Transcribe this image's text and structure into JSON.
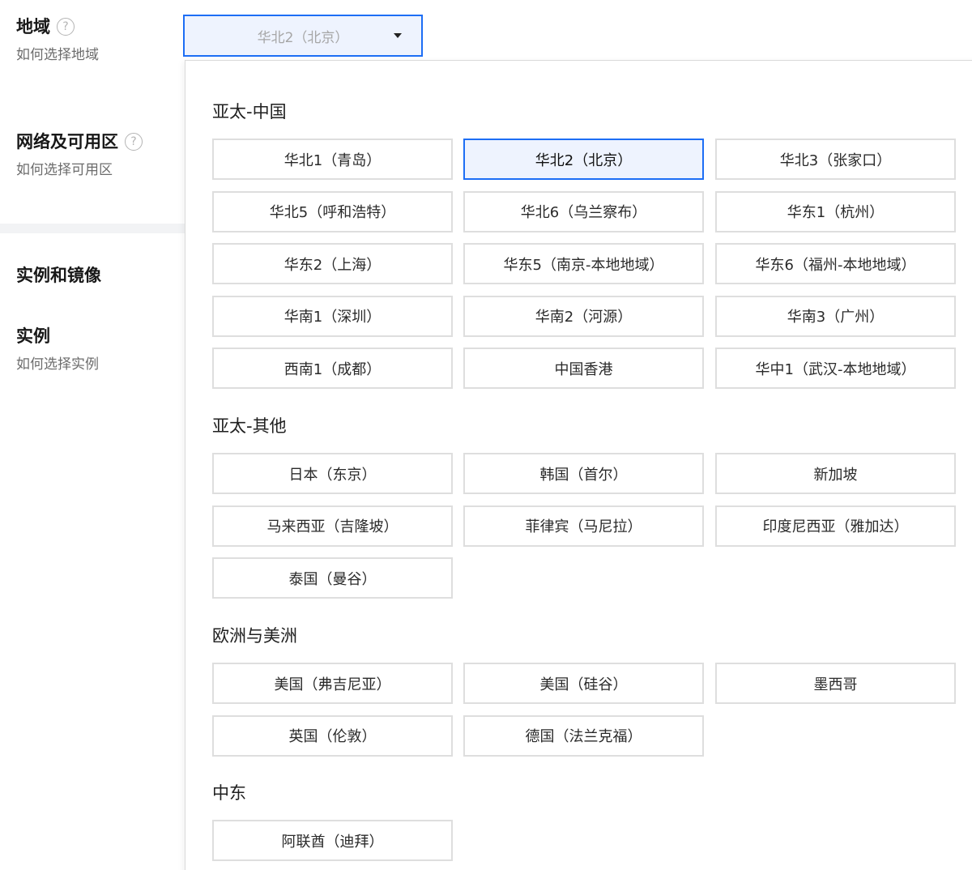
{
  "form": {
    "region": {
      "title": "地域",
      "help_link": "如何选择地域"
    },
    "network": {
      "title": "网络及可用区",
      "help_link": "如何选择可用区"
    },
    "section_title": "实例和镜像",
    "instance": {
      "title": "实例",
      "help_link": "如何选择实例"
    },
    "help_glyph": "?"
  },
  "select": {
    "value": "华北2（北京）"
  },
  "dropdown": {
    "groups": [
      {
        "title": "亚太-中国",
        "options": [
          "华北1（青岛）",
          "华北2（北京）",
          "华北3（张家口）",
          "华北5（呼和浩特）",
          "华北6（乌兰察布）",
          "华东1（杭州）",
          "华东2（上海）",
          "华东5（南京-本地地域）",
          "华东6（福州-本地地域）",
          "华南1（深圳）",
          "华南2（河源）",
          "华南3（广州）",
          "西南1（成都）",
          "中国香港",
          "华中1（武汉-本地地域）"
        ]
      },
      {
        "title": "亚太-其他",
        "options": [
          "日本（东京）",
          "韩国（首尔）",
          "新加坡",
          "马来西亚（吉隆坡）",
          "菲律宾（马尼拉）",
          "印度尼西亚（雅加达）",
          "泰国（曼谷）"
        ]
      },
      {
        "title": "欧洲与美洲",
        "options": [
          "美国（弗吉尼亚）",
          "美国（硅谷）",
          "墨西哥",
          "英国（伦敦）",
          "德国（法兰克福）"
        ]
      },
      {
        "title": "中东",
        "options": [
          "阿联酋（迪拜）"
        ]
      }
    ],
    "selected": "华北2（北京）"
  },
  "icons": {
    "help": "question-circle-icon",
    "caret": "caret-down-icon"
  },
  "colors": {
    "accent": "#1d6ef5",
    "selected_bg": "#eef3fe",
    "border": "#dedede"
  }
}
